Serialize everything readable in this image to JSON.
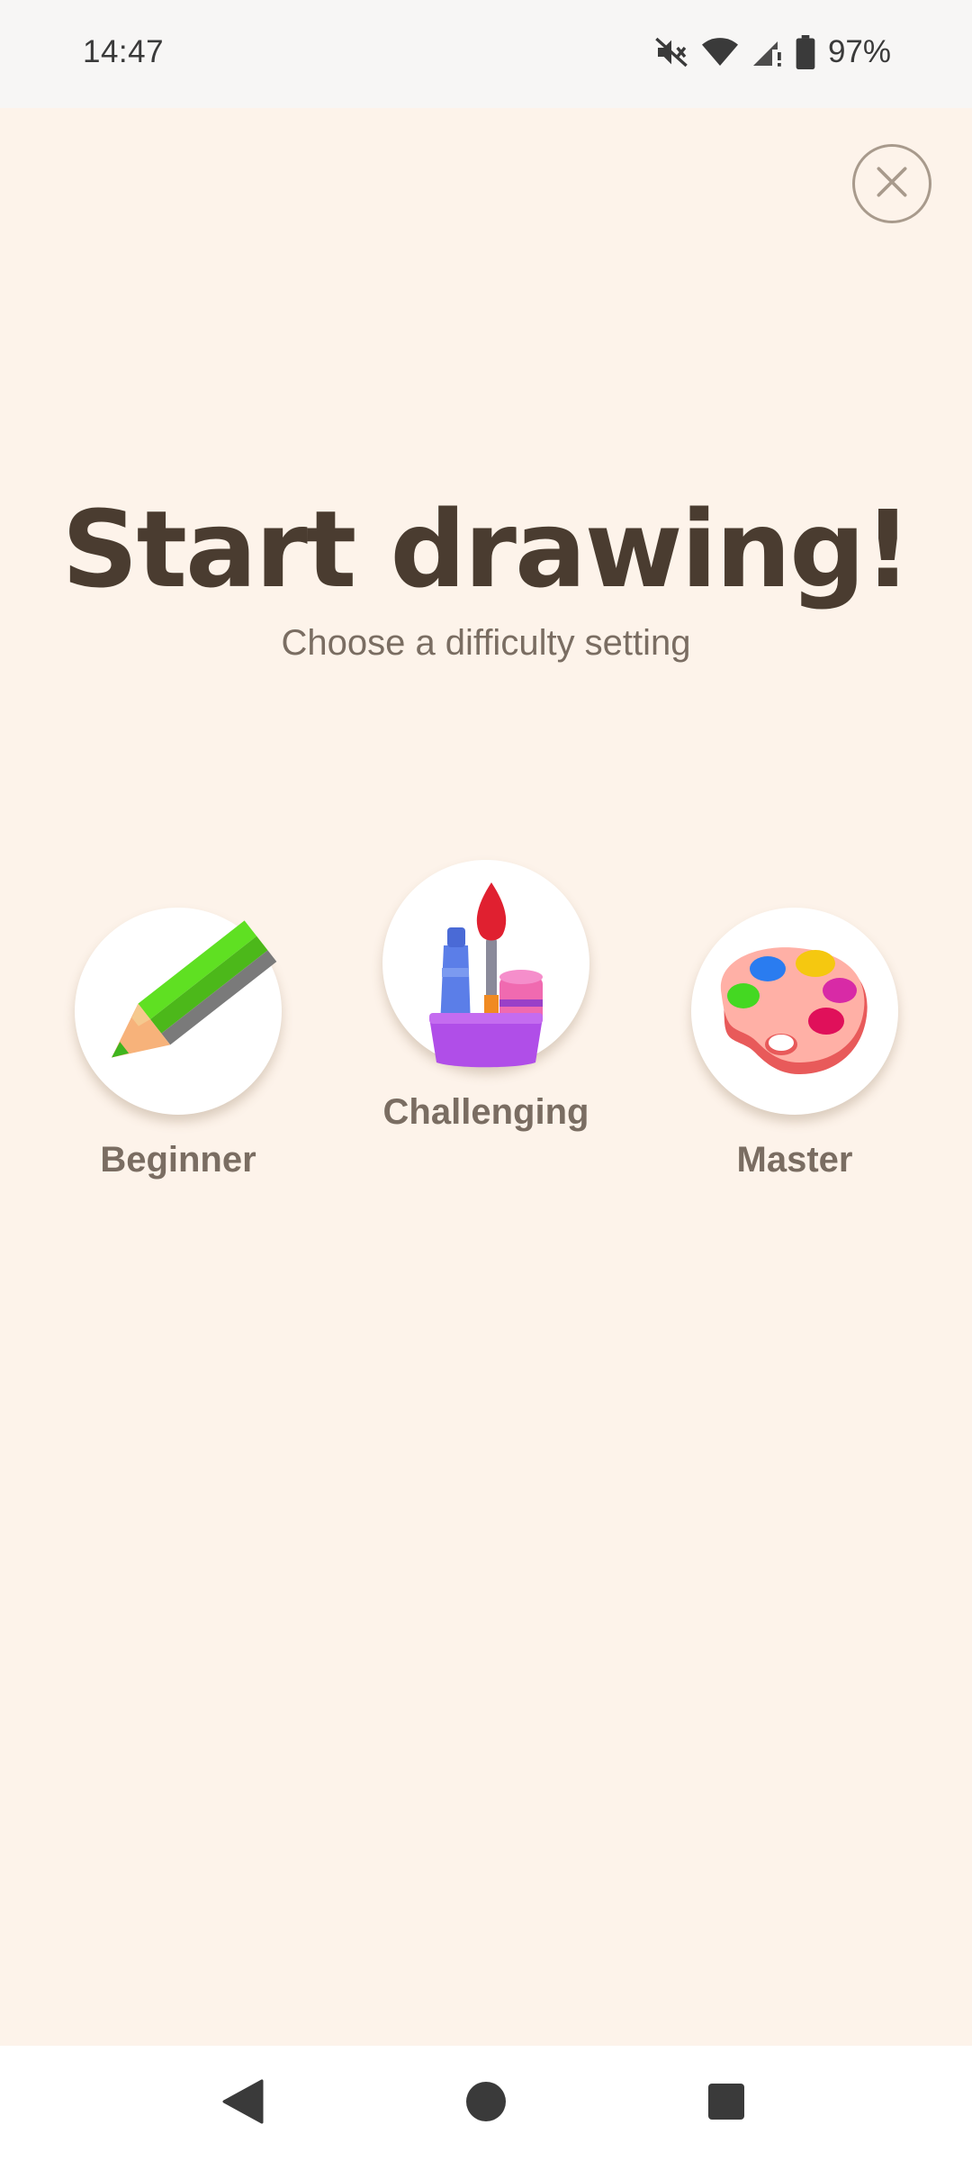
{
  "status_bar": {
    "time": "14:47",
    "battery": "97%",
    "icons": [
      "mute-icon",
      "wifi-icon",
      "signal-icon",
      "battery-icon"
    ]
  },
  "header": {
    "close_icon": "close-icon"
  },
  "main": {
    "title": "Start drawing!",
    "subtitle": "Choose a difficulty setting",
    "options": [
      {
        "label": "Beginner",
        "icon": "pencil-icon"
      },
      {
        "label": "Challenging",
        "icon": "art-supplies-icon"
      },
      {
        "label": "Master",
        "icon": "palette-icon"
      }
    ]
  },
  "nav_bar": {
    "icons": [
      "back-icon",
      "home-icon",
      "recents-icon"
    ]
  },
  "colors": {
    "background": "#fdf3ea",
    "title": "#4a3c30",
    "label": "#7a6d62"
  }
}
